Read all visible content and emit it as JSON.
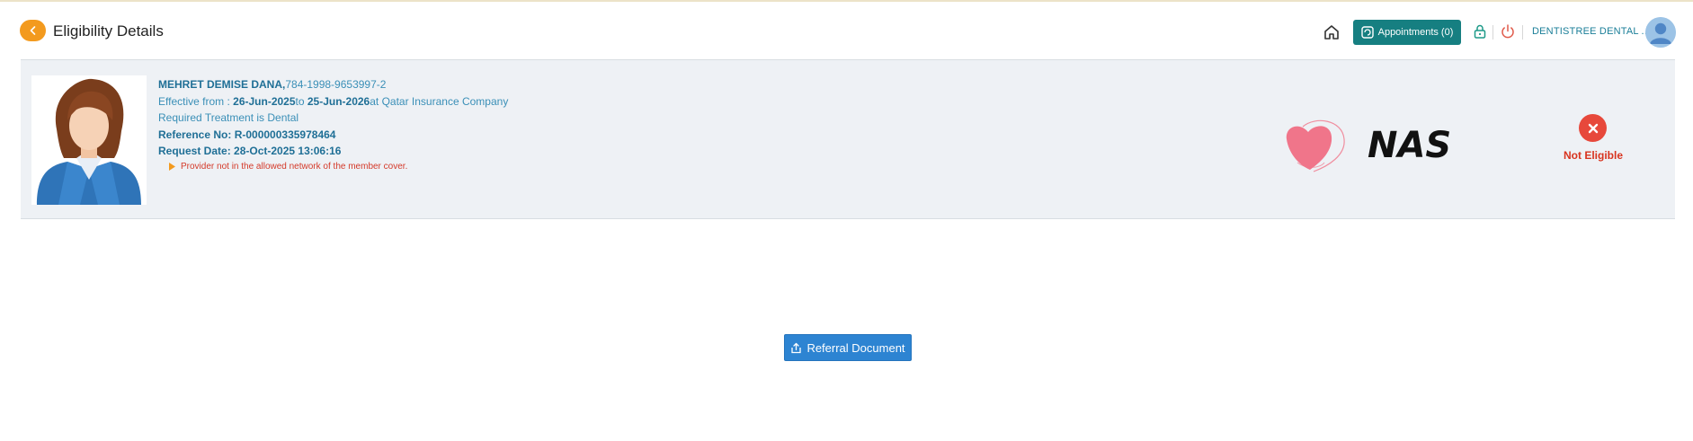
{
  "header": {
    "title": "Eligibility Details",
    "appointments_label": "Appointments (0)",
    "clinic_name": "DENTISTREE DENTAL ..."
  },
  "member": {
    "name": "MEHRET DEMISE DANA,",
    "id": "784-1998-9653997-2",
    "effective_prefix": "Effective from : ",
    "effective_from": "26-Jun-2025",
    "effective_to_prefix": "to ",
    "effective_to": "25-Jun-2026",
    "insurer_text": "at Qatar Insurance Company",
    "treatment": "Required Treatment is Dental",
    "reference": "Reference No: R-000000335978464",
    "request_date": "Request Date: 28-Oct-2025 13:06:16",
    "reason": "Provider not in the allowed network of the member cover."
  },
  "logo": {
    "text": "NAS"
  },
  "status": {
    "label": "Not Eligible",
    "color": "#e7483b"
  },
  "actions": {
    "referral_label": "Referral Document"
  },
  "colors": {
    "accent_orange": "#f39a1e",
    "accent_teal": "#167f81",
    "primary_blue": "#2d84d2",
    "error_red": "#d8341f"
  },
  "icons": [
    "chevron-left-icon",
    "home-icon",
    "refresh-icon",
    "lock-icon",
    "power-icon",
    "user-avatar-icon",
    "close-icon",
    "caret-right-icon",
    "upload-icon"
  ]
}
